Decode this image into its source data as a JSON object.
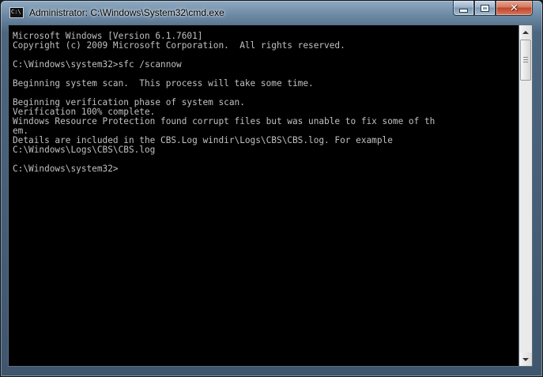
{
  "window": {
    "title": "Administrator: C:\\Windows\\System32\\cmd.exe",
    "app_icon_text": "C:\\",
    "app_icon": "cmd-icon"
  },
  "caption_buttons": {
    "minimize": "minimize-icon",
    "maximize": "maximize-icon",
    "close": "close-icon",
    "close_glyph": "✕"
  },
  "console": {
    "foreground": "#c0c0c0",
    "background": "#000000",
    "lines": [
      "Microsoft Windows [Version 6.1.7601]",
      "Copyright (c) 2009 Microsoft Corporation.  All rights reserved.",
      "",
      "C:\\Windows\\system32>sfc /scannow",
      "",
      "Beginning system scan.  This process will take some time.",
      "",
      "Beginning verification phase of system scan.",
      "Verification 100% complete.",
      "Windows Resource Protection found corrupt files but was unable to fix some of th",
      "em.",
      "Details are included in the CBS.Log windir\\Logs\\CBS\\CBS.log. For example",
      "C:\\Windows\\Logs\\CBS\\CBS.log",
      "",
      "C:\\Windows\\system32>"
    ]
  },
  "scrollbar": {
    "up_icon": "scroll-up-arrow-icon",
    "down_icon": "scroll-down-arrow-icon"
  }
}
